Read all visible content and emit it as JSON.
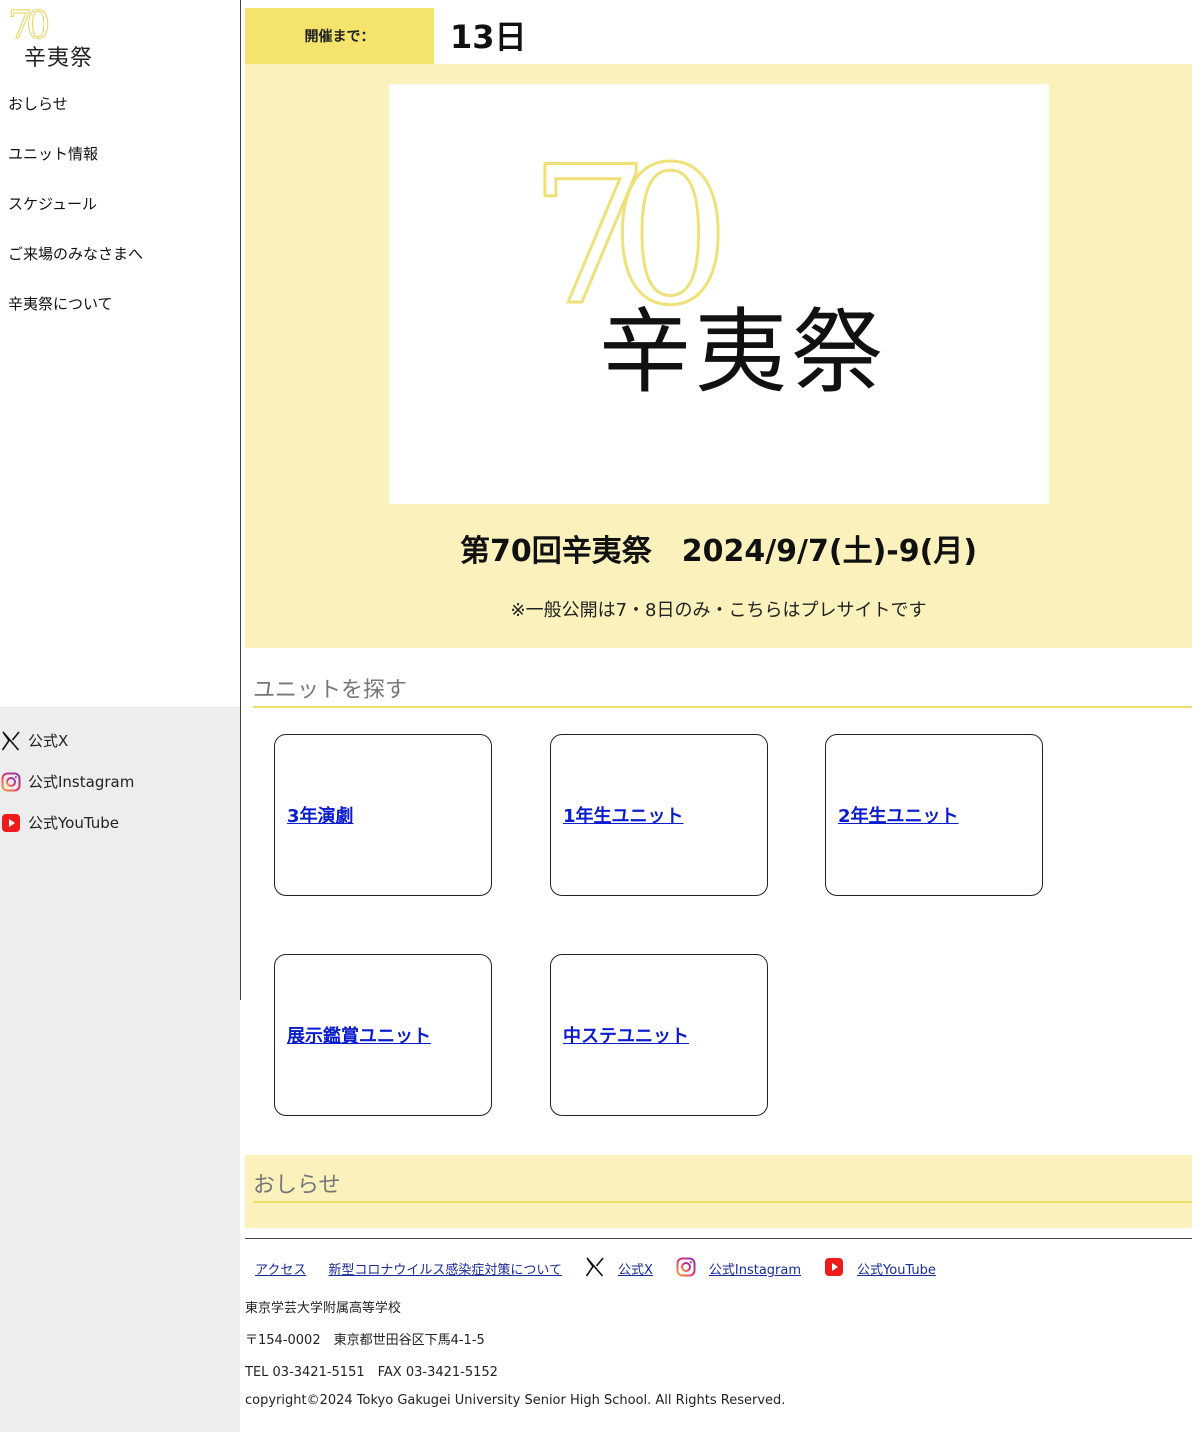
{
  "sidebar": {
    "logo": {
      "number": "70",
      "text": "辛夷祭"
    },
    "nav": [
      "おしらせ",
      "ユニット情報",
      "スケジュール",
      "ご来場のみなさまへ",
      "辛夷祭について"
    ],
    "social": [
      {
        "icon": "x-icon",
        "label": "公式X"
      },
      {
        "icon": "instagram-icon",
        "label": "公式Instagram"
      },
      {
        "icon": "youtube-icon",
        "label": "公式YouTube"
      }
    ]
  },
  "countdown": {
    "label": "開催まで：",
    "value": "13日"
  },
  "hero": {
    "logo_number": "70",
    "logo_text": "辛夷祭",
    "title": "第70回辛夷祭　2024/9/7(土)-9(月)",
    "subtitle": "※一般公開は7・8日のみ・こちらはプレサイトです"
  },
  "units": {
    "heading": "ユニットを探す",
    "cards": [
      "3年演劇",
      "1年生ユニット",
      "2年生ユニット",
      "展示鑑賞ユニット",
      "中ステユニット"
    ]
  },
  "news": {
    "heading": "おしらせ"
  },
  "footer": {
    "links": [
      {
        "label": "アクセス",
        "icon": ""
      },
      {
        "label": "新型コロナウイルス感染症対策について",
        "icon": ""
      },
      {
        "label": "公式X",
        "icon": "x-icon"
      },
      {
        "label": "公式Instagram",
        "icon": "instagram-icon"
      },
      {
        "label": "公式YouTube",
        "icon": "youtube-icon"
      }
    ],
    "school": "東京学芸大学附属高等学校",
    "address": "〒154-0002　東京都世田谷区下馬4-1-5",
    "phone": "TEL 03-3421-5151　FAX 03-3421-5152",
    "copyright": "copyright©2024 Tokyo Gakugei University Senior High School. All Rights Reserved."
  },
  "colors": {
    "accent": "#f4e46e",
    "hero_bg": "#faf1bc",
    "link": "#0b1ccf",
    "sidebar_grey": "#ededed"
  }
}
